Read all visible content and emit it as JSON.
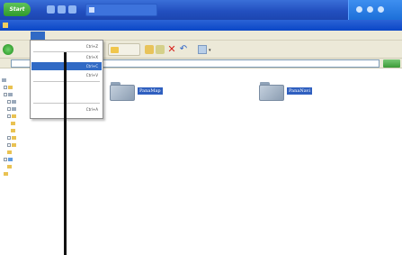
{
  "taskbar": {
    "start_label": "Start",
    "task_title": "",
    "task_title_icon": "folder-icon"
  },
  "window": {
    "title": ""
  },
  "menubar": {
    "items": [
      {
        "label": ""
      },
      {
        "label": ""
      },
      {
        "label": ""
      },
      {
        "label": ""
      },
      {
        "label": ""
      },
      {
        "label": ""
      }
    ]
  },
  "toolbar": {
    "folder_button_label": ""
  },
  "address": {
    "label": "",
    "value": ""
  },
  "dropdown": {
    "items": [
      {
        "label": "",
        "shortcut": "Ctrl+Z"
      },
      {
        "label": "",
        "shortcut": "Ctrl+X"
      },
      {
        "label": "",
        "shortcut": "Ctrl+C"
      },
      {
        "label": "",
        "shortcut": "Ctrl+V"
      },
      {
        "label": "",
        "shortcut": ""
      },
      {
        "label": "",
        "shortcut": ""
      },
      {
        "label": "",
        "shortcut": "Ctrl+A"
      }
    ]
  },
  "tree": {
    "header": ""
  },
  "files": [
    {
      "name": "PanaMap"
    },
    {
      "name": "PanaNavi"
    }
  ],
  "colors": {
    "selection": "#316ac5",
    "taskbar": "#2350c0",
    "titlebar": "#0a46c6",
    "chrome": "#ece9d8"
  }
}
